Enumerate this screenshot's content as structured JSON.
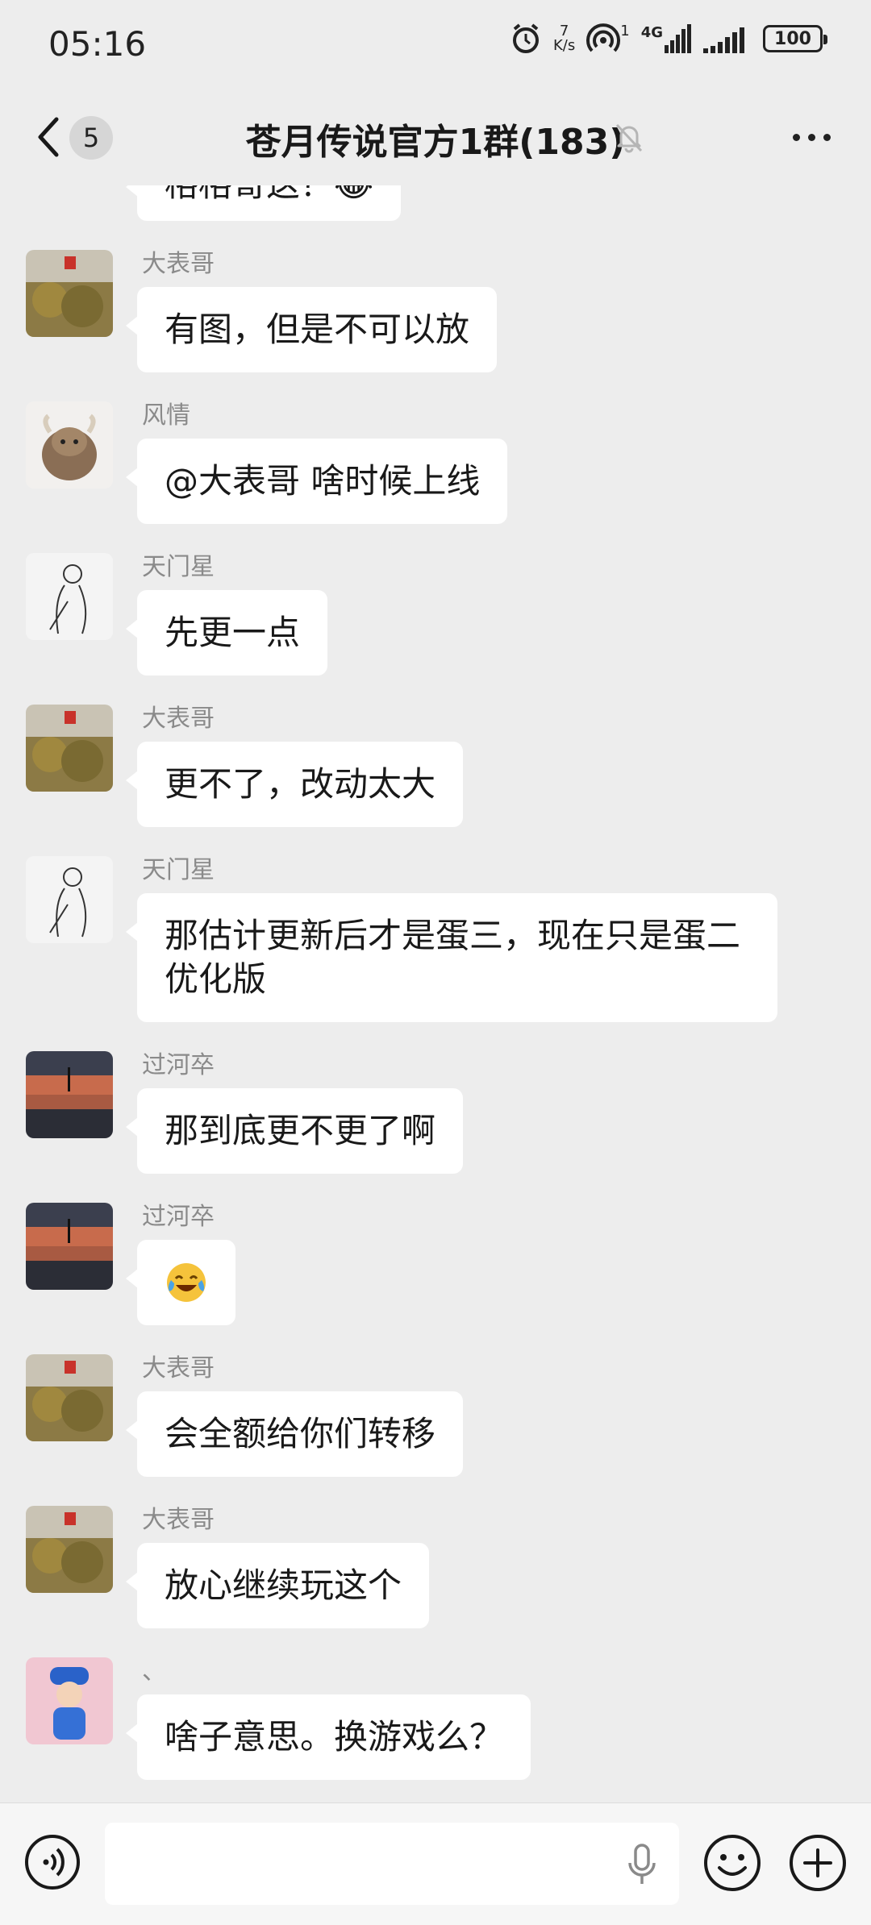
{
  "status": {
    "time": "05:16",
    "net_speed_value": "7",
    "net_speed_unit": "K/s",
    "hotspot_count": "1",
    "network_type": "4G",
    "battery": "100"
  },
  "nav": {
    "unread_count": "5",
    "title": "苍月传说官方1群(183)"
  },
  "messages": [
    {
      "sender": "大表哥",
      "text": "有图，但是不可以放",
      "avatar": "rock-plant-avatar"
    },
    {
      "sender": "风情",
      "text": "@大表哥  啥时候上线",
      "avatar": "yak-avatar"
    },
    {
      "sender": "天门星",
      "text": "先更一点",
      "avatar": "sketch-avatar"
    },
    {
      "sender": "大表哥",
      "text": "更不了，改动太大",
      "avatar": "rock-plant-avatar"
    },
    {
      "sender": "天门星",
      "text": "那估计更新后才是蛋三，现在只是蛋二优化版",
      "avatar": "sketch-avatar"
    },
    {
      "sender": "过河卒",
      "text": "那到底更不更了啊",
      "avatar": "sunset-avatar"
    },
    {
      "sender": "过河卒",
      "text": "😂",
      "avatar": "sunset-avatar"
    },
    {
      "sender": "大表哥",
      "text": "会全额给你们转移",
      "avatar": "rock-plant-avatar"
    },
    {
      "sender": "大表哥",
      "text": "放心继续玩这个",
      "avatar": "rock-plant-avatar"
    },
    {
      "sender": "、",
      "text": "啥子意思。换游戏么？",
      "avatar": "blue-cap-avatar"
    }
  ],
  "partial_top_message": {
    "text": "格格哥这？😂"
  },
  "colors": {
    "background": "#ededed",
    "bubble": "#ffffff",
    "sender": "#8a8a8a",
    "input_bar": "#f6f6f6"
  }
}
